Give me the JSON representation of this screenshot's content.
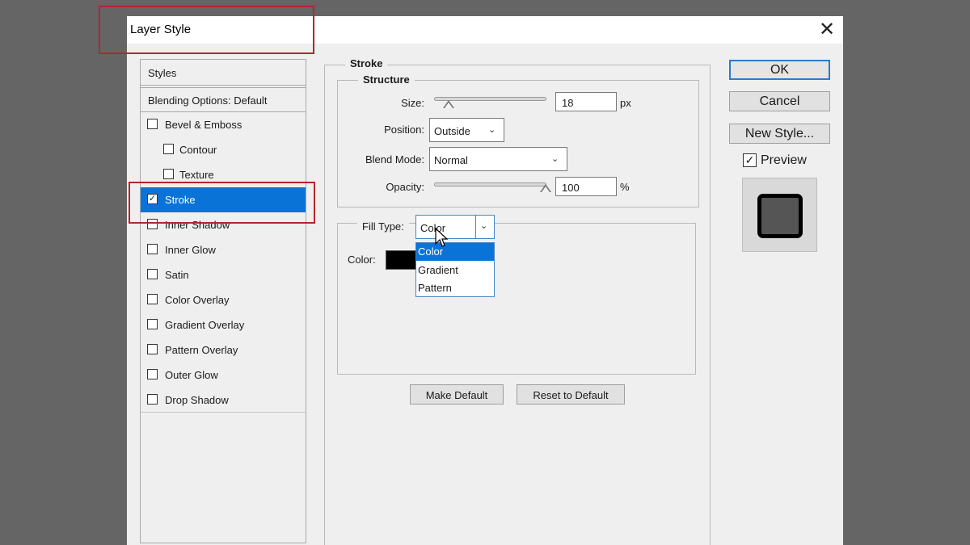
{
  "window": {
    "title": "Layer Style",
    "close_glyph": "✕"
  },
  "styles_panel": {
    "header": "Styles",
    "blending_options": "Blending Options: Default",
    "items": [
      {
        "label": "Bevel & Emboss",
        "checked": false
      },
      {
        "label": "Contour",
        "checked": false
      },
      {
        "label": "Texture",
        "checked": false
      },
      {
        "label": "Stroke",
        "checked": true,
        "selected": true
      },
      {
        "label": "Inner Shadow",
        "checked": false
      },
      {
        "label": "Inner Glow",
        "checked": false
      },
      {
        "label": "Satin",
        "checked": false
      },
      {
        "label": "Color Overlay",
        "checked": false
      },
      {
        "label": "Gradient Overlay",
        "checked": false
      },
      {
        "label": "Pattern Overlay",
        "checked": false
      },
      {
        "label": "Outer Glow",
        "checked": false
      },
      {
        "label": "Drop Shadow",
        "checked": false
      }
    ]
  },
  "stroke": {
    "group_title": "Stroke",
    "structure_title": "Structure",
    "size": {
      "label": "Size:",
      "value": "18",
      "unit": "px"
    },
    "position": {
      "label": "Position:",
      "value": "Outside"
    },
    "blend_mode": {
      "label": "Blend Mode:",
      "value": "Normal"
    },
    "opacity": {
      "label": "Opacity:",
      "value": "100",
      "unit": "%"
    },
    "fill_type": {
      "label": "Fill Type:",
      "value": "Color",
      "options": [
        "Color",
        "Gradient",
        "Pattern"
      ],
      "highlighted": "Color"
    },
    "color": {
      "label": "Color:",
      "swatch": "#000000"
    }
  },
  "buttons": {
    "make_default": "Make Default",
    "reset_default": "Reset to Default",
    "ok": "OK",
    "cancel": "Cancel",
    "new_style": "New Style...",
    "preview_label": "Preview",
    "preview_checked": true
  },
  "colors": {
    "selection": "#0a73d8",
    "highlight_box": "#b0282c",
    "ok_border": "#2a7ad0"
  }
}
